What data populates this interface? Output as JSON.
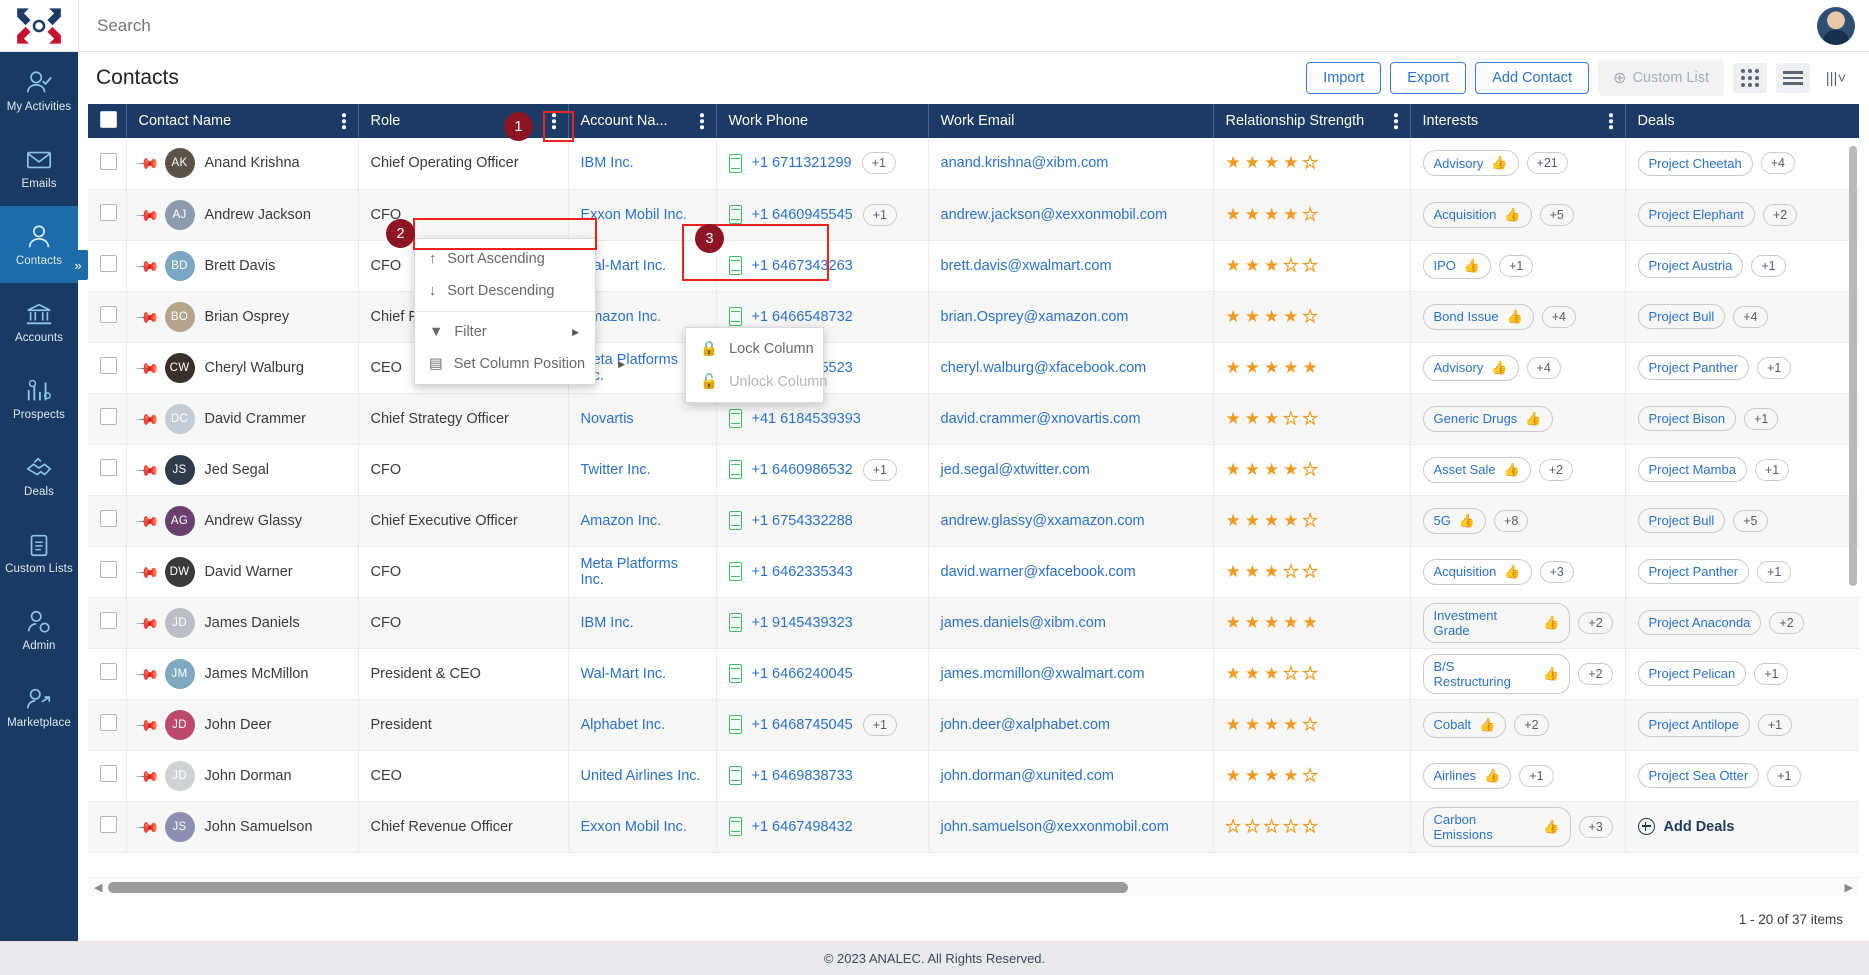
{
  "app": {
    "search_placeholder": "Search",
    "page_title": "Contacts",
    "footer": "© 2023 ANALEC. All Rights Reserved.",
    "pager": "1 - 20 of 37 items"
  },
  "sidebar": {
    "items": [
      {
        "label": "My Activities",
        "icon": "user-check-icon"
      },
      {
        "label": "Emails",
        "icon": "envelope-icon"
      },
      {
        "label": "Contacts",
        "icon": "user-icon",
        "active": true
      },
      {
        "label": "Accounts",
        "icon": "bank-icon"
      },
      {
        "label": "Prospects",
        "icon": "chart-gear-icon"
      },
      {
        "label": "Deals",
        "icon": "handshake-icon"
      },
      {
        "label": "Custom Lists",
        "icon": "clipboard-list-icon"
      },
      {
        "label": "Admin",
        "icon": "user-gear-icon"
      },
      {
        "label": "Marketplace",
        "icon": "user-share-icon"
      }
    ],
    "collapse_label": "»"
  },
  "toolbar": {
    "import": "Import",
    "export": "Export",
    "add_contact": "Add Contact",
    "custom_list": "Custom List"
  },
  "table": {
    "columns": [
      {
        "label": "",
        "kebab": false
      },
      {
        "label": "Contact Name",
        "kebab": true
      },
      {
        "label": "Role",
        "kebab": true
      },
      {
        "label": "Account Na...",
        "kebab": true
      },
      {
        "label": "Work Phone",
        "kebab": false
      },
      {
        "label": "Work Email",
        "kebab": false
      },
      {
        "label": "Relationship Strength",
        "kebab": true
      },
      {
        "label": "Interests",
        "kebab": true
      },
      {
        "label": "Deals",
        "kebab": false
      }
    ],
    "rows": [
      {
        "pinned": true,
        "initials": "AK",
        "avatar_color": "#5a5348",
        "name": "Anand Krishna",
        "role": "Chief Operating Officer",
        "account": "IBM Inc.",
        "phone": "+1 6711321299",
        "phone_extra": "+1",
        "email": "anand.krishna@xibm.com",
        "stars": 4,
        "interest": "Advisory",
        "interest_extra": "+21",
        "deal": "Project Cheetah",
        "deal_extra": "+4"
      },
      {
        "pinned": true,
        "initials": "AJ",
        "avatar_color": "#8c9cae",
        "name": "Andrew Jackson",
        "role": "CFO",
        "account": "Exxon Mobil Inc.",
        "phone": "+1 6460945545",
        "phone_extra": "+1",
        "email": "andrew.jackson@xexxonmobil.com",
        "stars": 4,
        "interest": "Acquisition",
        "interest_extra": "+5",
        "deal": "Project Elephant",
        "deal_extra": "+2"
      },
      {
        "pinned": true,
        "initials": "BD",
        "avatar_color": "#7ba7c4",
        "name": "Brett Davis",
        "role": "CFO",
        "account": "Wal-Mart Inc.",
        "phone": "+1 6467343263",
        "phone_extra": "",
        "email": "brett.davis@xwalmart.com",
        "stars": 3,
        "interest": "IPO",
        "interest_extra": "+1",
        "deal": "Project Austria",
        "deal_extra": "+1"
      },
      {
        "pinned": true,
        "initials": "BO",
        "avatar_color": "#b6a48c",
        "name": "Brian Osprey",
        "role": "Chief Financial Officer",
        "account": "Amazon Inc.",
        "phone": "+1 6466548732",
        "phone_extra": "",
        "email": "brian.Osprey@xamazon.com",
        "stars": 4,
        "interest": "Bond Issue",
        "interest_extra": "+4",
        "deal": "Project Bull",
        "deal_extra": "+4"
      },
      {
        "pinned": true,
        "initials": "CW",
        "avatar_color": "#3b3027",
        "name": "Cheryl Walburg",
        "role": "CEO",
        "account": "Meta Platforms Inc.",
        "phone": "+1 6468825523",
        "phone_extra": "",
        "email": "cheryl.walburg@xfacebook.com",
        "stars": 5,
        "interest": "Advisory",
        "interest_extra": "+4",
        "deal": "Project Panther",
        "deal_extra": "+1"
      },
      {
        "pinned": true,
        "initials": "DC",
        "avatar_color": "#c2cdd6",
        "name": "David Crammer",
        "role": "Chief Strategy Officer",
        "account": "Novartis",
        "phone": "+41 6184539393",
        "phone_extra": "",
        "email": "david.crammer@xnovartis.com",
        "stars": 3,
        "interest": "Generic Drugs",
        "interest_extra": "",
        "deal": "Project Bison",
        "deal_extra": "+1"
      },
      {
        "pinned": true,
        "initials": "JS",
        "avatar_color": "#2f3b4a",
        "name": "Jed Segal",
        "role": "CFO",
        "account": "Twitter Inc.",
        "phone": "+1 6460986532",
        "phone_extra": "+1",
        "email": "jed.segal@xtwitter.com",
        "stars": 4,
        "interest": "Asset Sale",
        "interest_extra": "+2",
        "deal": "Project Mamba",
        "deal_extra": "+1"
      },
      {
        "pinned": false,
        "initials": "AG",
        "avatar_color": "#6b3f6e",
        "name": "Andrew Glassy",
        "role": "Chief Executive Officer",
        "account": "Amazon Inc.",
        "phone": "+1 6754332288",
        "phone_extra": "",
        "email": "andrew.glassy@xxamazon.com",
        "stars": 4,
        "interest": "5G",
        "interest_extra": "+8",
        "deal": "Project Bull",
        "deal_extra": "+5"
      },
      {
        "pinned": false,
        "initials": "DW",
        "avatar_color": "#3a3a3a",
        "name": "David Warner",
        "role": "CFO",
        "account": "Meta Platforms Inc.",
        "phone": "+1 6462335343",
        "phone_extra": "",
        "email": "david.warner@xfacebook.com",
        "stars": 3,
        "interest": "Acquisition",
        "interest_extra": "+3",
        "deal": "Project Panther",
        "deal_extra": "+1"
      },
      {
        "pinned": false,
        "initials": "JD",
        "avatar_color": "#b9bfc4",
        "name": "James Daniels",
        "role": "CFO",
        "account": "IBM Inc.",
        "phone": "+1 9145439323",
        "phone_extra": "",
        "email": "james.daniels@xibm.com",
        "stars": 5,
        "interest": "Investment Grade",
        "interest_extra": "+2",
        "deal": "Project Anaconda",
        "deal_extra": "+2"
      },
      {
        "pinned": false,
        "initials": "JM",
        "avatar_color": "#7fa9c0",
        "name": "James McMillon",
        "role": "President & CEO",
        "account": "Wal-Mart Inc.",
        "phone": "+1 6466240045",
        "phone_extra": "",
        "email": "james.mcmillon@xwalmart.com",
        "stars": 3,
        "interest": "B/S Restructuring",
        "interest_extra": "+2",
        "deal": "Project Pelican",
        "deal_extra": "+1"
      },
      {
        "pinned": false,
        "initials": "JD",
        "avatar_color": "#bc4a6b",
        "name": "John Deer",
        "role": "President",
        "account": "Alphabet Inc.",
        "phone": "+1 6468745045",
        "phone_extra": "+1",
        "email": "john.deer@xalphabet.com",
        "stars": 4,
        "interest": "Cobalt",
        "interest_extra": "+2",
        "deal": "Project Antilope",
        "deal_extra": "+1"
      },
      {
        "pinned": false,
        "initials": "JD",
        "avatar_color": "#cfd3d6",
        "name": "John Dorman",
        "role": "CEO",
        "account": "United Airlines Inc.",
        "phone": "+1 6469838733",
        "phone_extra": "",
        "email": "john.dorman@xunited.com",
        "stars": 4,
        "interest": "Airlines",
        "interest_extra": "+1",
        "deal": "Project Sea Otter",
        "deal_extra": "+1"
      },
      {
        "pinned": false,
        "initials": "JS",
        "avatar_color": "#8b90b0",
        "name": "John Samuelson",
        "role": "Chief Revenue Officer",
        "account": "Exxon Mobil Inc.",
        "phone": "+1 6467498432",
        "phone_extra": "",
        "email": "john.samuelson@xexxonmobil.com",
        "stars": 0,
        "interest": "Carbon Emissions",
        "interest_extra": "+3",
        "deal": "",
        "deal_extra": "",
        "deal_add": "Add Deals"
      }
    ]
  },
  "context_menu": {
    "items": [
      {
        "label": "Sort Ascending",
        "icon": "arrow-up-icon"
      },
      {
        "label": "Sort Descending",
        "icon": "arrow-down-icon"
      },
      {
        "label": "Filter",
        "icon": "funnel-icon",
        "submenu": true
      },
      {
        "label": "Set Column Position",
        "icon": "columns-icon",
        "submenu": true,
        "highlighted": true
      }
    ],
    "submenu": {
      "items": [
        {
          "label": "Lock Column",
          "icon": "lock-icon",
          "disabled": false
        },
        {
          "label": "Unlock Column",
          "icon": "unlock-icon",
          "disabled": true
        }
      ]
    }
  },
  "annotations": [
    {
      "number": "1",
      "target": "role-column-kebab"
    },
    {
      "number": "2",
      "target": "set-column-position-item"
    },
    {
      "number": "3",
      "target": "lock-unlock-submenu"
    }
  ],
  "colors": {
    "sidebar": "#183a63",
    "header": "#1b3a66",
    "accent_link": "#2a72cf",
    "star": "#ef9a20",
    "annotation": "#8c1423",
    "highlight": "#ef2121"
  }
}
